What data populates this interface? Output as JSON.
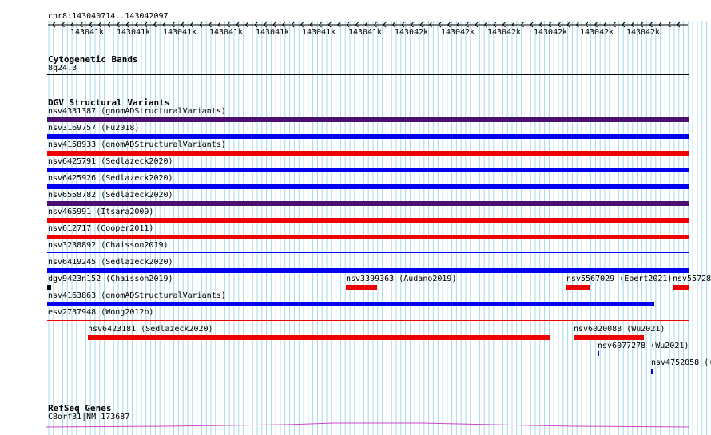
{
  "ruler": {
    "location": "chr8:143040714..143042097",
    "ticks": [
      "143041k",
      "143041k",
      "143041k",
      "143041k",
      "143041k",
      "143041k",
      "143041k",
      "143042k",
      "143042k",
      "143042k",
      "143042k",
      "143042k",
      "143042k"
    ]
  },
  "tracks": {
    "cytoband": {
      "title": "Cytogenetic Bands",
      "band": "8q24.3"
    },
    "dgv": {
      "title": "DGV Structural Variants",
      "rows": [
        {
          "label": "nsv4331387 (gnomADStructuralVariants)",
          "color": "#4b0f72"
        },
        {
          "label": "nsv3169757 (Fu2018)",
          "color": "#0000ee"
        },
        {
          "label": "nsv4158933 (gnomADStructuralVariants)",
          "color": "#ee0000"
        },
        {
          "label": "nsv6425791 (Sedlazeck2020)",
          "color": "#0000ee"
        },
        {
          "label": "nsv6425926 (Sedlazeck2020)",
          "color": "#0000ee"
        },
        {
          "label": "nsv6558782 (Sedlazeck2020)",
          "color": "#4b0f72"
        },
        {
          "label": "nsv465991 (Itsara2009)",
          "color": "#ee0000"
        },
        {
          "label": "nsv612717 (Cooper2011)",
          "color": "#ee0000"
        },
        {
          "label": "nsv3238892 (Chaisson2019)",
          "color": "#0000ee"
        },
        {
          "label": "nsv6419245 (Sedlazeck2020)",
          "color": "#0000ee"
        }
      ],
      "row_dgv": {
        "label_1": "dgv9423n152 (Chaisson2019)",
        "label_2": "nsv3399363 (Audano2019)",
        "label_3": "nsv5567029 (Ebert2021)",
        "label_4": "nsv55728"
      },
      "row_gnomad2": {
        "label": "nsv4163863 (gnomADStructuralVariants)",
        "color": "#0000ee"
      },
      "row_esv": {
        "label": "esv2737948 (Wong2012b)",
        "color": "#ee0000"
      },
      "row_last": {
        "label_1": "nsv6423181 (Sedlazeck2020)",
        "label_2": "nsv6020088 (Wu2021)",
        "label_3": "nsv6077278 (Wu2021)",
        "label_4": "nsv4752058 (("
      }
    },
    "refseq": {
      "title": "RefSeq Genes",
      "gene": "C8orf31|NM_173687"
    }
  },
  "colors": {
    "blue": "#0000ee",
    "red": "#ee0000",
    "purple": "#4b0f72",
    "grid": "#a8d8e8",
    "gene": "#cc44cc"
  }
}
